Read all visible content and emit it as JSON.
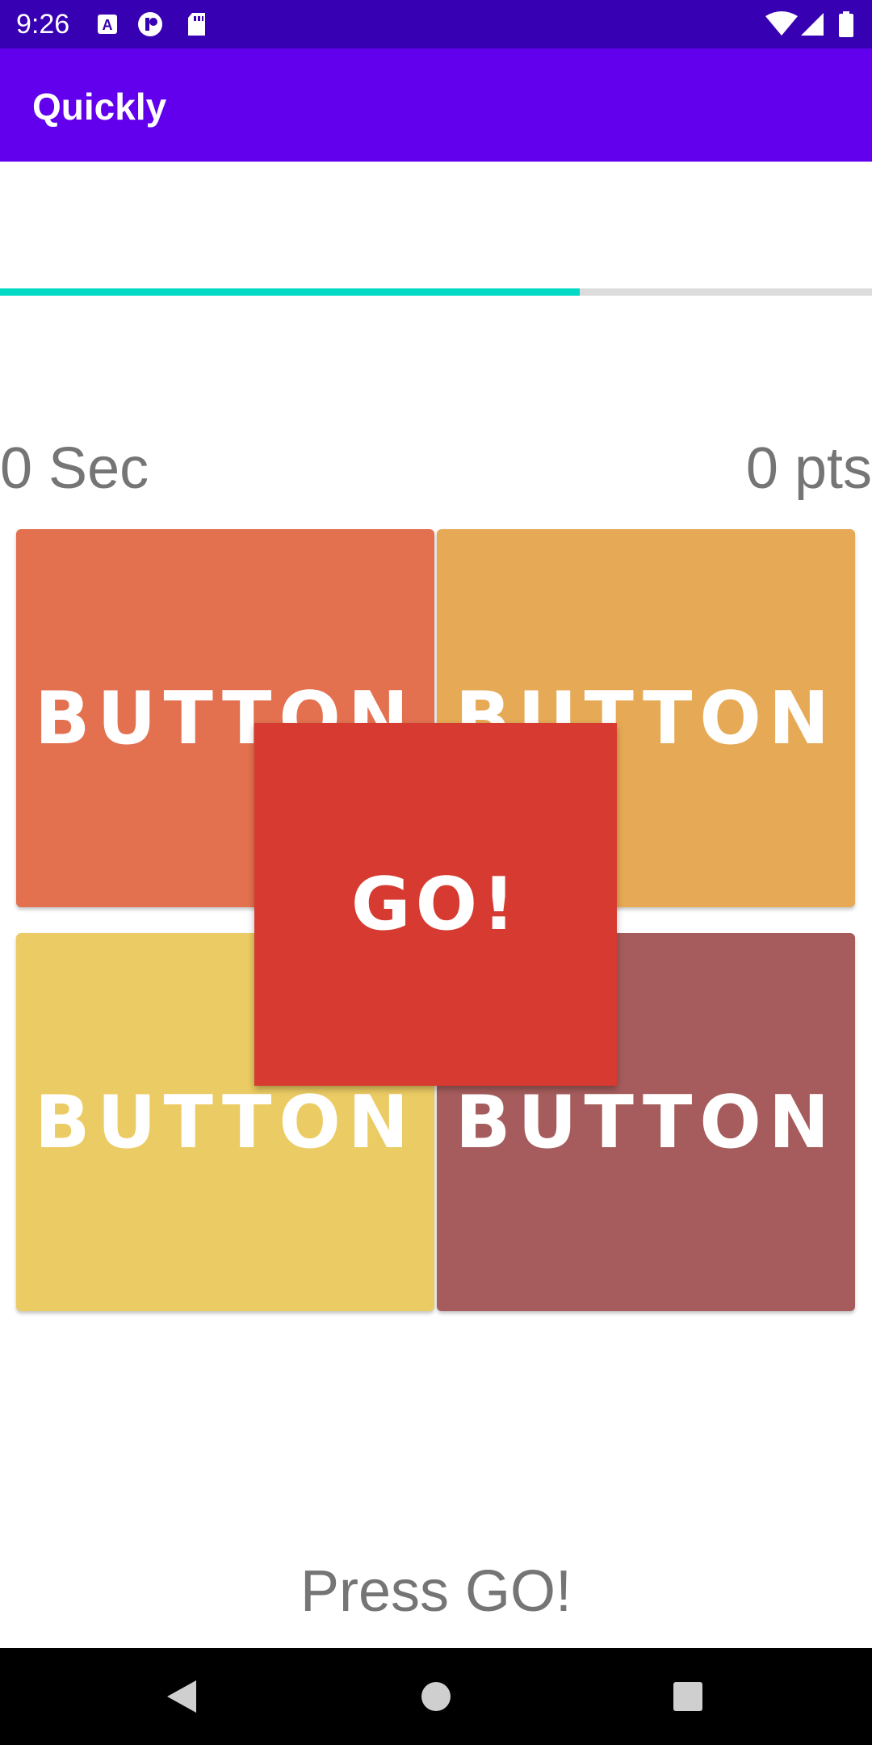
{
  "status_bar": {
    "time": "9:26",
    "left_icons": [
      "a-box-icon",
      "p-circle-icon",
      "sd-card-icon"
    ],
    "right_icons": [
      "wifi-icon",
      "signal-icon",
      "battery-icon"
    ]
  },
  "app_bar": {
    "title": "Quickly"
  },
  "progress": {
    "value": 0.665,
    "fill_color": "#03dac5",
    "track_color": "#dcdcdc"
  },
  "stats": {
    "timer": "0 Sec",
    "score": "0 pts"
  },
  "tiles": [
    {
      "label": "BUTTON",
      "color": "#e37150"
    },
    {
      "label": "BUTTON",
      "color": "#e6aa56"
    },
    {
      "label": "BUTTON",
      "color": "#ebcb63"
    },
    {
      "label": "BUTTON",
      "color": "#a65c5c"
    }
  ],
  "go_button": {
    "label": "GO!",
    "color": "#d63a30"
  },
  "hint": "Press GO!",
  "nav_bar": {
    "icons": [
      "back-icon",
      "home-icon",
      "recents-icon"
    ]
  }
}
